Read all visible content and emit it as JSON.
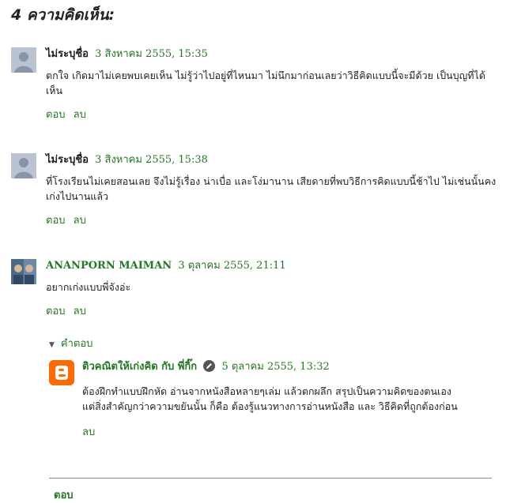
{
  "heading": "4 ความคิดเห็น:",
  "comments": [
    {
      "author": "ไม่ระบุชื่อ",
      "date": "3 สิงหาคม 2555, 15:35",
      "text": "ตกใจ เกิดมาไม่เคยพบเคยเห็น ไม่รู้ว่าไปอยู่ที่ไหนมา ไม่นึกมาก่อนเลยว่าวิธีคิดแบบนี้จะมีด้วย เป็นบุญที่ได้เห็น",
      "reply_label": "ตอบ",
      "delete_label": "ลบ"
    },
    {
      "author": "ไม่ระบุชื่อ",
      "date": "3 สิงหาคม 2555, 15:38",
      "text": "ที่โรงเรียนไม่เคยสอนเลย จึงไม่รู้เรื่อง น่าเบื่อ และโง่มานาน เสียดายที่พบวิธีการคิดแบบนี้ช้าไป ไม่เช่นนั้นคงเก่งไปนานแล้ว",
      "reply_label": "ตอบ",
      "delete_label": "ลบ"
    },
    {
      "author": "ANANPORN MAIMAN",
      "date": "3 ตุลาคม 2555, 21:11",
      "text": "อยากเก่งแบบพี่จังอ่ะ",
      "reply_label": "ตอบ",
      "delete_label": "ลบ"
    }
  ],
  "replies_toggle": "คำตอบ",
  "reply": {
    "author": "ติวคณิตให้เก่งคิด กับ พี่กิ๊ก",
    "date": "5 ตุลาคม 2555, 13:32",
    "line1": "ต้องฝึกทำแบบฝึกหัด อ่านจากหนังสือหลายๆเล่ม แล้วตกผลึก สรุปเป็นความคิดของตนเอง",
    "line2": "แต่สิ่งสำคัญกว่าความขยันนั้น ก็คือ ต้องรู้แนวทางการอ่านหนังสือ และ วิธีคิดที่ถูกต้องก่อน",
    "delete_label": "ลบ"
  },
  "bottom_reply": "ตอบ",
  "colors": {
    "link": "#227722",
    "blogger": "#ff6b00"
  }
}
